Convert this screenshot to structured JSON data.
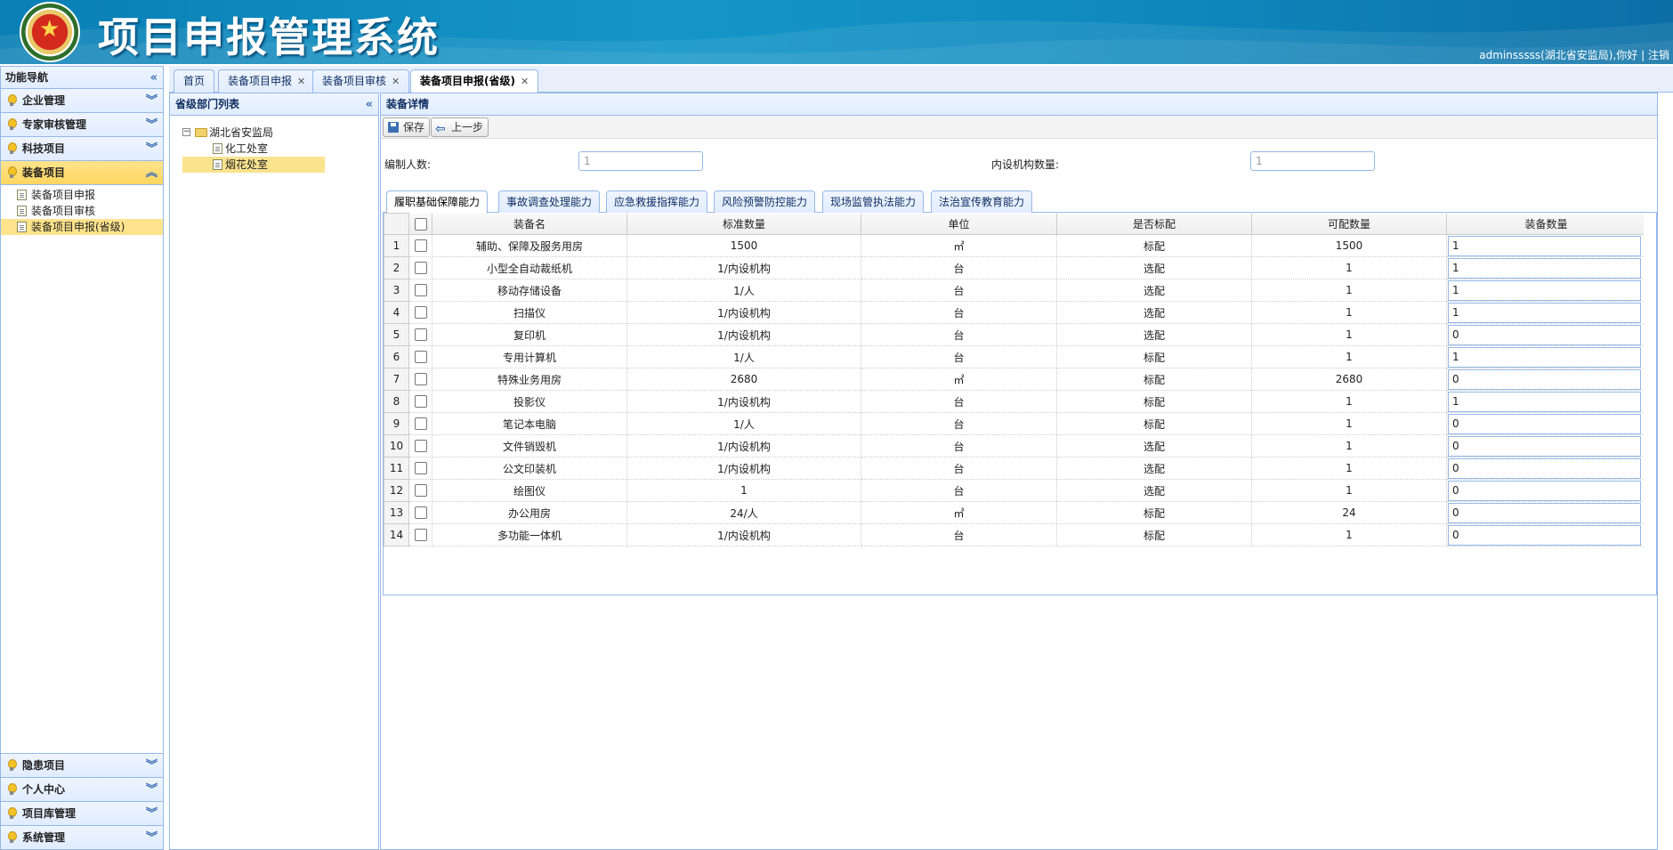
{
  "app": {
    "title": "项目申报管理系统",
    "user_text": "adminsssss(湖北省安监局),你好",
    "separator": "|",
    "logout_label": "注销"
  },
  "nav": {
    "title": "功能导航",
    "groups_top": [
      {
        "label": "企业管理",
        "active": false
      },
      {
        "label": "专家审核管理",
        "active": false
      },
      {
        "label": "科技项目",
        "active": false
      },
      {
        "label": "装备项目",
        "active": true
      }
    ],
    "active_items": [
      {
        "label": "装备项目申报",
        "selected": false
      },
      {
        "label": "装备项目审核",
        "selected": false
      },
      {
        "label": "装备项目申报(省级)",
        "selected": true
      }
    ],
    "groups_bottom": [
      {
        "label": "隐患项目"
      },
      {
        "label": "个人中心"
      },
      {
        "label": "项目库管理"
      },
      {
        "label": "系统管理"
      }
    ]
  },
  "tabs": [
    {
      "label": "首页",
      "closable": false,
      "active": false
    },
    {
      "label": "装备项目申报",
      "closable": true,
      "active": false
    },
    {
      "label": "装备项目审核",
      "closable": true,
      "active": false
    },
    {
      "label": "装备项目申报(省级)",
      "closable": true,
      "active": true
    }
  ],
  "dept_panel": {
    "title": "省级部门列表",
    "root": "湖北省安监局",
    "children": [
      {
        "label": "化工处室",
        "selected": false
      },
      {
        "label": "烟花处室",
        "selected": true
      }
    ]
  },
  "detail": {
    "title": "装备详情",
    "toolbar": {
      "save_label": "保存",
      "back_label": "上一步"
    },
    "form": {
      "staff_label": "编制人数:",
      "staff_value": "1",
      "org_label": "内设机构数量:",
      "org_value": "1"
    },
    "inner_tabs": [
      {
        "label": "履职基础保障能力",
        "active": true
      },
      {
        "label": "事故调查处理能力",
        "active": false
      },
      {
        "label": "应急救援指挥能力",
        "active": false
      },
      {
        "label": "风险预警防控能力",
        "active": false
      },
      {
        "label": "现场监管执法能力",
        "active": false
      },
      {
        "label": "法治宣传教育能力",
        "active": false
      }
    ],
    "columns": [
      "装备名",
      "标准数量",
      "单位",
      "是否标配",
      "可配数量",
      "装备数量"
    ],
    "rows": [
      {
        "n": "1",
        "name": "辅助、保障及服务用房",
        "std": "1500",
        "unit": "㎡",
        "type": "标配",
        "avail": "1500",
        "qty": "1"
      },
      {
        "n": "2",
        "name": "小型全自动裁纸机",
        "std": "1/内设机构",
        "unit": "台",
        "type": "选配",
        "avail": "1",
        "qty": "1"
      },
      {
        "n": "3",
        "name": "移动存储设备",
        "std": "1/人",
        "unit": "台",
        "type": "选配",
        "avail": "1",
        "qty": "1"
      },
      {
        "n": "4",
        "name": "扫描仪",
        "std": "1/内设机构",
        "unit": "台",
        "type": "选配",
        "avail": "1",
        "qty": "1"
      },
      {
        "n": "5",
        "name": "复印机",
        "std": "1/内设机构",
        "unit": "台",
        "type": "选配",
        "avail": "1",
        "qty": "0"
      },
      {
        "n": "6",
        "name": "专用计算机",
        "std": "1/人",
        "unit": "台",
        "type": "标配",
        "avail": "1",
        "qty": "1"
      },
      {
        "n": "7",
        "name": "特殊业务用房",
        "std": "2680",
        "unit": "㎡",
        "type": "标配",
        "avail": "2680",
        "qty": "0"
      },
      {
        "n": "8",
        "name": "投影仪",
        "std": "1/内设机构",
        "unit": "台",
        "type": "标配",
        "avail": "1",
        "qty": "1"
      },
      {
        "n": "9",
        "name": "笔记本电脑",
        "std": "1/人",
        "unit": "台",
        "type": "标配",
        "avail": "1",
        "qty": "0"
      },
      {
        "n": "10",
        "name": "文件销毁机",
        "std": "1/内设机构",
        "unit": "台",
        "type": "选配",
        "avail": "1",
        "qty": "0"
      },
      {
        "n": "11",
        "name": "公文印装机",
        "std": "1/内设机构",
        "unit": "台",
        "type": "选配",
        "avail": "1",
        "qty": "0"
      },
      {
        "n": "12",
        "name": "绘图仪",
        "std": "1",
        "unit": "台",
        "type": "选配",
        "avail": "1",
        "qty": "0"
      },
      {
        "n": "13",
        "name": "办公用房",
        "std": "24/人",
        "unit": "㎡",
        "type": "标配",
        "avail": "24",
        "qty": "0"
      },
      {
        "n": "14",
        "name": "多功能一体机",
        "std": "1/内设机构",
        "unit": "台",
        "type": "标配",
        "avail": "1",
        "qty": "0"
      }
    ]
  }
}
